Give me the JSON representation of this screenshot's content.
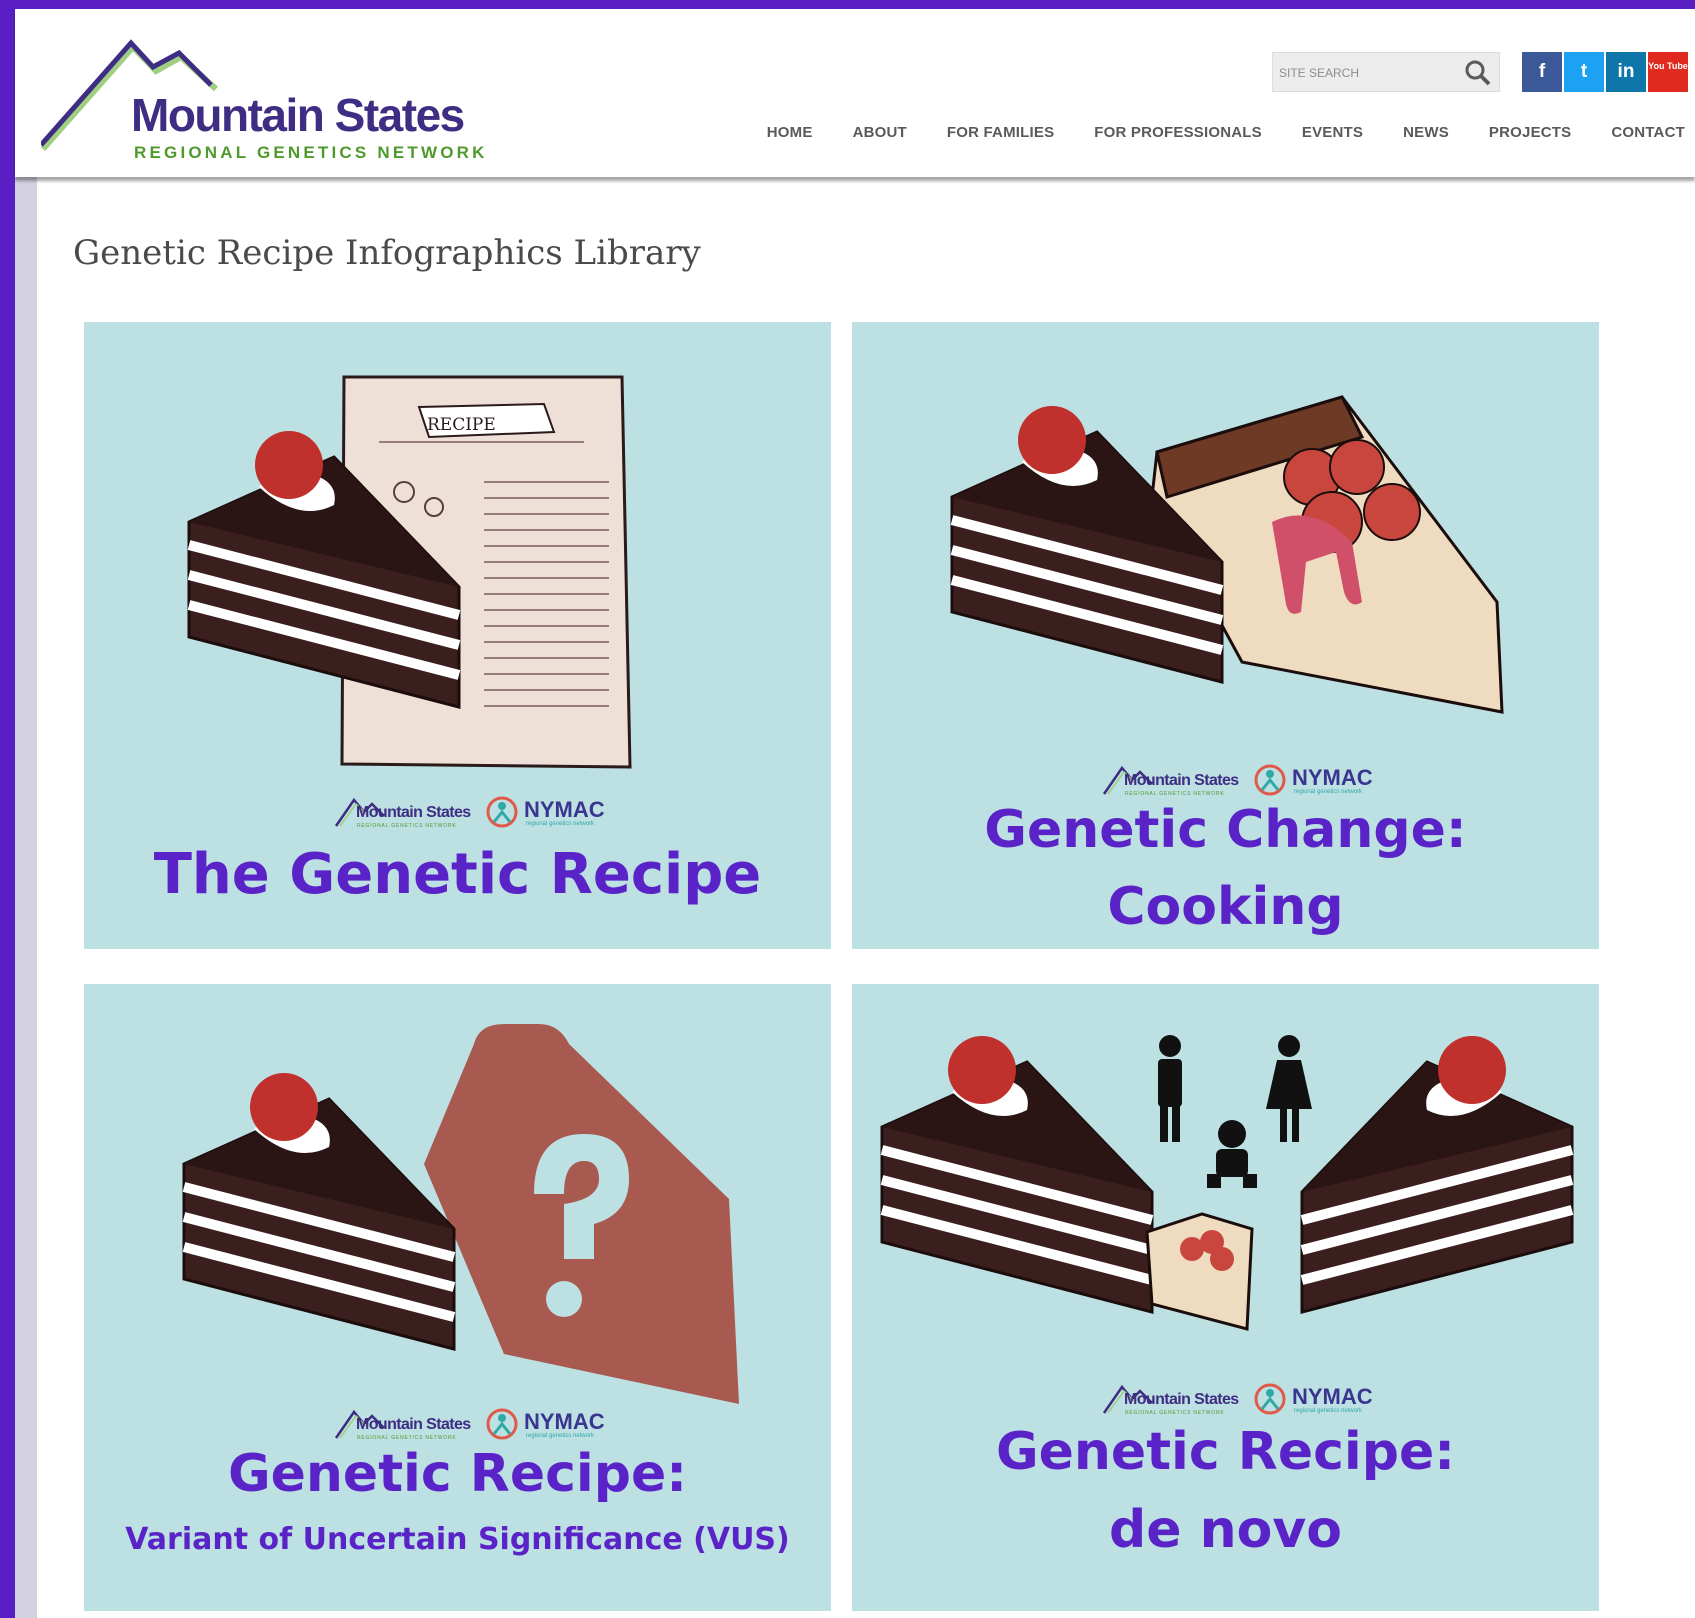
{
  "site": {
    "logo_title": "Mountain States",
    "logo_subtitle": "REGIONAL GENETICS NETWORK"
  },
  "search": {
    "placeholder": "SITE SEARCH"
  },
  "social": [
    {
      "label": "f",
      "icon": "facebook-icon",
      "color": "#3b5998"
    },
    {
      "label": "t",
      "icon": "twitter-icon",
      "color": "#1da1f2"
    },
    {
      "label": "in",
      "icon": "linkedin-icon",
      "color": "#0e76a8"
    },
    {
      "label": "You Tube",
      "icon": "youtube-icon",
      "color": "#e02a20"
    }
  ],
  "nav": [
    "HOME",
    "ABOUT",
    "FOR FAMILIES",
    "FOR PROFESSIONALS",
    "EVENTS",
    "NEWS",
    "PROJECTS",
    "CONTACT"
  ],
  "page_title": "Genetic Recipe Infographics Library",
  "cards": [
    {
      "title": "The Genetic Recipe",
      "subtitle": ""
    },
    {
      "title": "Genetic Change:",
      "subtitle": "Cooking"
    },
    {
      "title": "Genetic Recipe:",
      "subtitle": "Variant of Uncertain Significance (VUS)"
    },
    {
      "title": "Genetic Recipe:",
      "subtitle": "de novo"
    }
  ],
  "partner_logos": {
    "mountain_states": "Mountain States",
    "mountain_states_sub": "REGIONAL GENETICS NETWORK",
    "nymac": "NYMAC",
    "nymac_sub": "regional genetics network"
  },
  "recipe_label": "RECIPE",
  "colors": {
    "brand_purple": "#5a23c8",
    "brand_green": "#4f9a2c",
    "card_bg": "#bde0e3"
  }
}
